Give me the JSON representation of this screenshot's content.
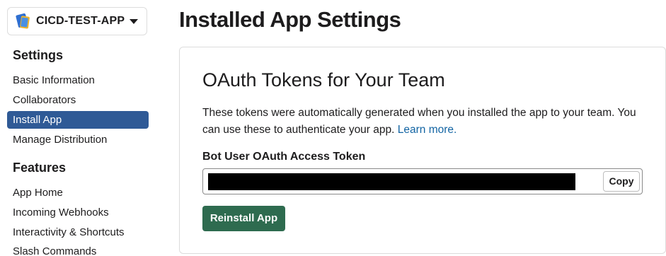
{
  "app_switcher": {
    "app_name": "CICD-TEST-APP",
    "icon": "books-icon"
  },
  "sidebar": {
    "sections": [
      {
        "heading": "Settings",
        "items": [
          {
            "label": "Basic Information",
            "active": false
          },
          {
            "label": "Collaborators",
            "active": false
          },
          {
            "label": "Install App",
            "active": true
          },
          {
            "label": "Manage Distribution",
            "active": false
          }
        ]
      },
      {
        "heading": "Features",
        "items": [
          {
            "label": "App Home",
            "active": false
          },
          {
            "label": "Incoming Webhooks",
            "active": false
          },
          {
            "label": "Interactivity & Shortcuts",
            "active": false
          },
          {
            "label": "Slash Commands",
            "active": false
          }
        ]
      }
    ]
  },
  "main": {
    "page_title": "Installed App Settings",
    "card": {
      "title": "OAuth Tokens for Your Team",
      "description": "These tokens were automatically generated when you installed the app to your team. You can use these to authenticate your app.",
      "learn_more": "Learn more.",
      "token_label": "Bot User OAuth Access Token",
      "copy_label": "Copy",
      "reinstall_label": "Reinstall App"
    }
  },
  "colors": {
    "active_nav": "#2f5a96",
    "link": "#1264a3",
    "reinstall_button": "#2e6b4f"
  }
}
